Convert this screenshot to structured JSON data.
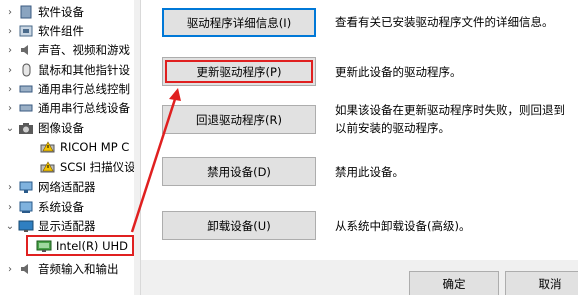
{
  "tree": {
    "items": [
      {
        "label": "软件设备",
        "expanded": false,
        "icon": "device-icon"
      },
      {
        "label": "软件组件",
        "expanded": false,
        "icon": "component-icon"
      },
      {
        "label": "声音、视频和游戏",
        "expanded": false,
        "icon": "speaker-icon"
      },
      {
        "label": "鼠标和其他指针设",
        "expanded": false,
        "icon": "mouse-icon"
      },
      {
        "label": "通用串行总线控制",
        "expanded": false,
        "icon": "usb-icon"
      },
      {
        "label": "通用串行总线设备",
        "expanded": false,
        "icon": "usb-icon"
      },
      {
        "label": "图像设备",
        "expanded": true,
        "icon": "camera-icon"
      },
      {
        "label": "RICOH MP C",
        "child": true,
        "icon": "scanner-warning-icon"
      },
      {
        "label": "SCSI 扫描仪设",
        "child": true,
        "icon": "scanner-warning-icon"
      },
      {
        "label": "网络适配器",
        "expanded": false,
        "icon": "network-icon"
      },
      {
        "label": "系统设备",
        "expanded": false,
        "icon": "system-icon"
      },
      {
        "label": "显示适配器",
        "expanded": true,
        "icon": "monitor-icon"
      },
      {
        "label": "Intel(R) UHD",
        "child": true,
        "selected": true,
        "icon": "display-adapter-icon"
      },
      {
        "label": "音频输入和输出",
        "expanded": false,
        "icon": "speaker-icon"
      }
    ]
  },
  "dialog": {
    "buttons": [
      {
        "label": "驱动程序详细信息(I)",
        "desc": "查看有关已安装驱动程序文件的详细信息。"
      },
      {
        "label": "更新驱动程序(P)",
        "desc": "更新此设备的驱动程序。"
      },
      {
        "label": "回退驱动程序(R)",
        "desc": "如果该设备在更新驱动程序时失败，则回退到以前安装的驱动程序。"
      },
      {
        "label": "禁用设备(D)",
        "desc": "禁用此设备。"
      },
      {
        "label": "卸载设备(U)",
        "desc": "从系统中卸载设备(高级)。"
      }
    ],
    "ok_label": "确定",
    "cancel_label": "取消"
  },
  "colors": {
    "highlight": "#e02020",
    "focus": "#0078d7"
  }
}
